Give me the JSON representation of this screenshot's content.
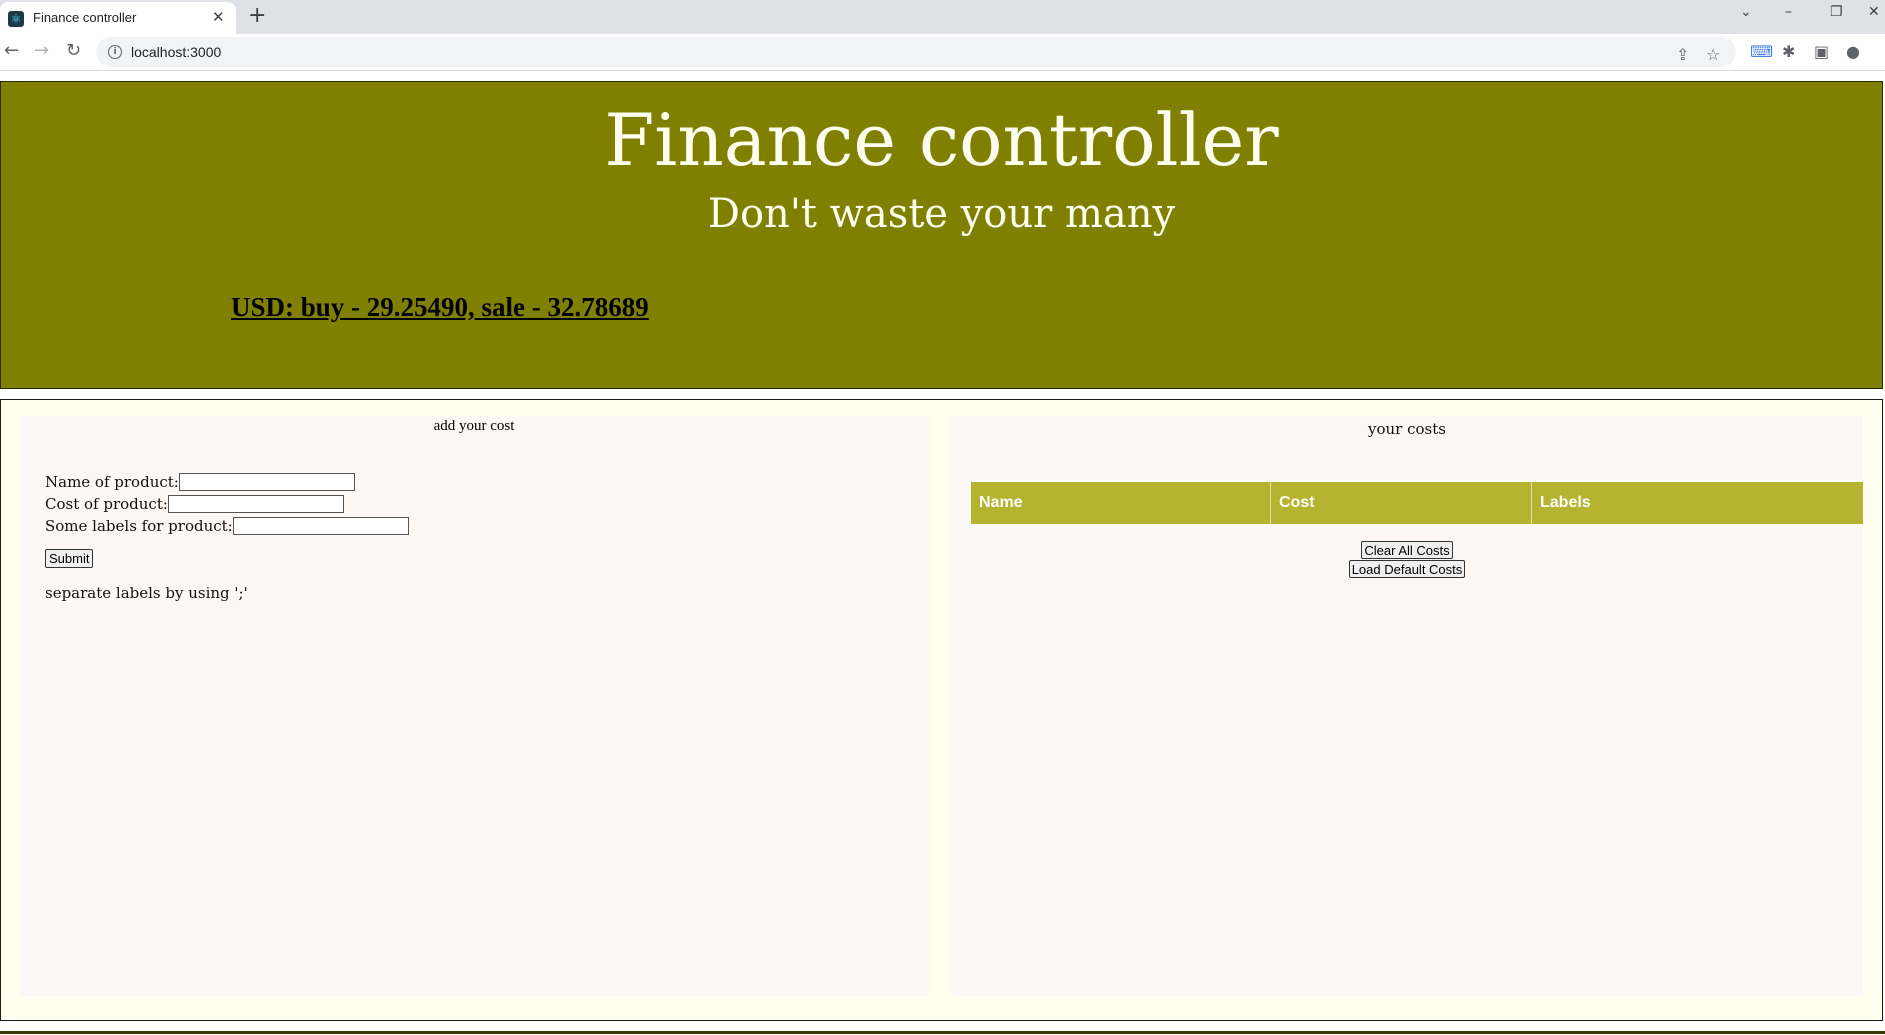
{
  "browser": {
    "tab_title": "Finance controller",
    "tab_close": "✕",
    "new_tab": "+",
    "url": "localhost:3000",
    "icons": [
      "react-favicon",
      "back-icon",
      "forward-icon",
      "reload-icon",
      "info-icon",
      "share-icon",
      "star-icon",
      "translate-icon",
      "extensions-icon",
      "sidepanel-icon",
      "profile-icon",
      "tab-search-icon",
      "minimize-icon",
      "restore-icon",
      "close-window-icon"
    ]
  },
  "header": {
    "title": "Finance controller",
    "subtitle": "Don't waste your many",
    "rate": "USD: buy - 29.25490, sale - 32.78689",
    "bg_color": "#808000"
  },
  "add_panel": {
    "heading": "add your cost",
    "name_label": "Name of product:",
    "cost_label": "Cost of product:",
    "labels_label": "Some labels for product:",
    "name_value": "",
    "cost_value": "",
    "labels_value": "",
    "submit_label": "Submit",
    "hint": "separate labels by using ';'"
  },
  "costs_panel": {
    "heading": "your costs",
    "columns": [
      "Name",
      "Cost",
      "Labels"
    ],
    "rows": [],
    "clear_label": "Clear All Costs",
    "load_label": "Load Default Costs",
    "header_color": "#b5b32f"
  }
}
